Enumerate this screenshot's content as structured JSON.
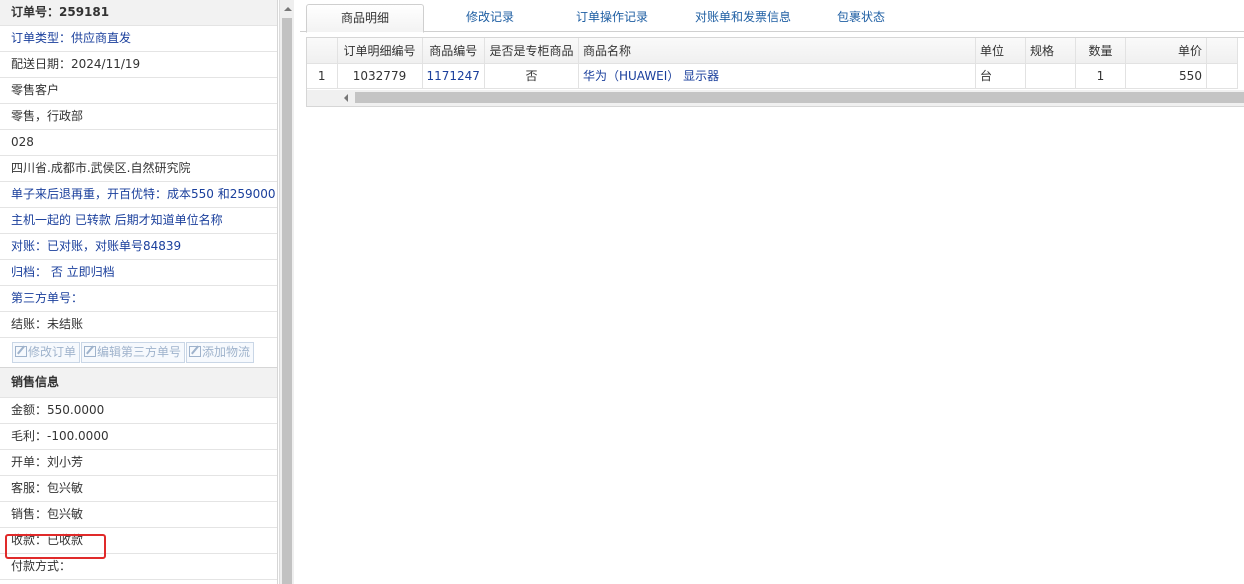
{
  "left": {
    "order_title": "订单号：259181",
    "rows": [
      {
        "text": "订单类型：供应商直发",
        "style": "blue"
      },
      {
        "text": "配送日期：2024/11/19",
        "style": "normal"
      },
      {
        "text": "零售客户",
        "style": "normal"
      },
      {
        "text": "零售，行政部",
        "style": "normal"
      },
      {
        "text": "028",
        "style": "normal"
      },
      {
        "text": "四川省.成都市.武侯区.自然研究院",
        "style": "normal"
      },
      {
        "text": "单子来后退再重，开百优特：成本550 和259000",
        "style": "blue"
      },
      {
        "text": "主机一起的 已转款 后期才知道单位名称",
        "style": "blue"
      },
      {
        "text": "对账：已对账，对账单号84839",
        "style": "blue"
      },
      {
        "text": "归档： 否 立即归档",
        "style": "blue"
      },
      {
        "text": "第三方单号：",
        "style": "blue"
      },
      {
        "text": "结账：未结账",
        "style": "normal"
      }
    ],
    "buttons": {
      "edit_order": "修改订单",
      "edit_third_party": "编辑第三方单号",
      "add_logistics": "添加物流"
    },
    "sales_title": "销售信息",
    "sales_rows": [
      "金额：550.0000",
      "毛利：-100.0000",
      "开单：刘小芳",
      "客服：包兴敏",
      "销售：包兴敏",
      "收款：已收款",
      "付款方式："
    ]
  },
  "tabs": [
    "商品明细",
    "修改记录",
    "订单操作记录",
    "对账单和发票信息",
    "包裹状态"
  ],
  "table": {
    "headers": [
      "",
      "订单明细编号",
      "商品编号",
      "是否是专柜商品",
      "商品名称",
      "单位",
      "规格",
      "数量",
      "单价"
    ],
    "row": {
      "index": "1",
      "detail_no": "1032779",
      "product_no": "1171247",
      "is_counter": "否",
      "name": "华为（HUAWEI） 显示器",
      "unit": "台",
      "spec": "",
      "qty": "1",
      "price": "550"
    }
  },
  "colors": {
    "highlight_box": "#e02a2a",
    "link_blue": "#1a3f9c"
  }
}
